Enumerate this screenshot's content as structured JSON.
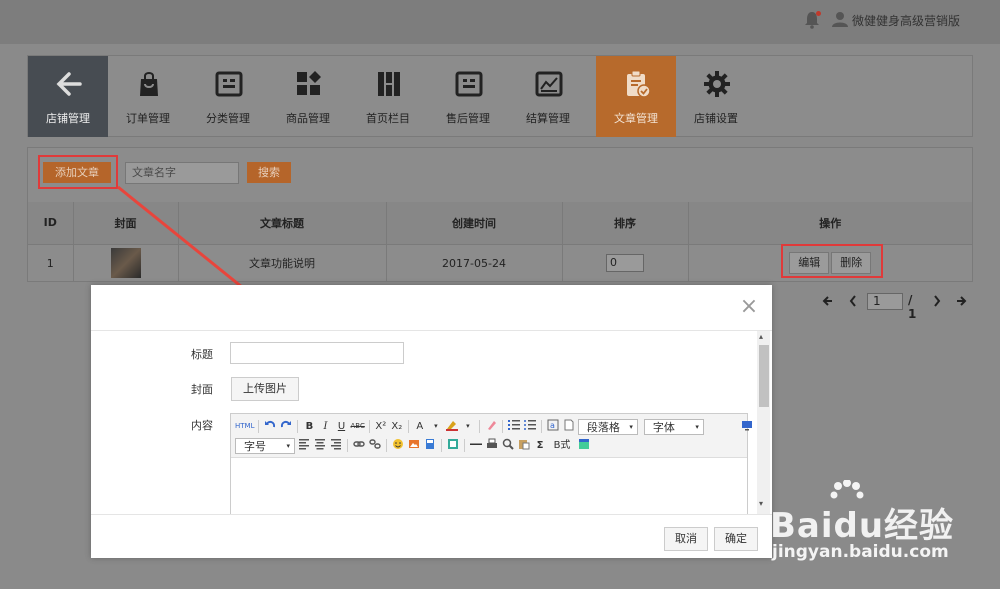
{
  "header": {
    "username": "微健健身高级营销版"
  },
  "nav": {
    "items": [
      {
        "label": "店铺管理",
        "icon": "back-arrow-icon"
      },
      {
        "label": "订单管理",
        "icon": "shopping-bag-icon"
      },
      {
        "label": "分类管理",
        "icon": "category-icon"
      },
      {
        "label": "商品管理",
        "icon": "products-grid-icon"
      },
      {
        "label": "首页栏目",
        "icon": "columns-icon"
      },
      {
        "label": "售后管理",
        "icon": "after-sales-icon"
      },
      {
        "label": "结算管理",
        "icon": "settlement-chart-icon"
      },
      {
        "label": "文章管理",
        "icon": "clipboard-check-icon"
      },
      {
        "label": "店铺设置",
        "icon": "gear-icon"
      }
    ]
  },
  "toolbar": {
    "add_label": "添加文章",
    "search_placeholder": "文章名字",
    "search_label": "搜索"
  },
  "table": {
    "headers": [
      "ID",
      "封面",
      "文章标题",
      "创建时间",
      "排序",
      "操作"
    ],
    "rows": [
      {
        "id": "1",
        "title": "文章功能说明",
        "created": "2017-05-24",
        "sort": "0",
        "edit": "编辑",
        "delete": "删除"
      }
    ]
  },
  "pager": {
    "current": "1",
    "total": "/ 1"
  },
  "modal": {
    "title_label": "标题",
    "cover_label": "封面",
    "upload_label": "上传图片",
    "content_label": "内容",
    "editor": {
      "paragraph_select": "段落格",
      "font_select": "字体",
      "size_select": "字号",
      "html_btn": "HTML",
      "bold": "B",
      "italic": "I",
      "underline": "U",
      "strike": "ABC",
      "superscript": "X²",
      "subscript": "X₂",
      "font_color": "A",
      "sigma": "Σ",
      "format_clear": "B式"
    },
    "cancel_label": "取消",
    "confirm_label": "确定"
  },
  "watermark": {
    "brand": "Baidu经验",
    "url": "jingyan.baidu.com"
  },
  "colors": {
    "accent": "#b76a2c",
    "back_bg": "#474c52",
    "highlight": "#e03a3a"
  }
}
